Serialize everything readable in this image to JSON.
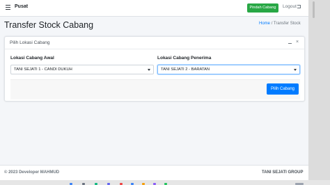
{
  "navbar": {
    "brand": "Pusat",
    "pindah_label": "Pindah Cabang",
    "logout_label": "Logout"
  },
  "header": {
    "title": "Transfer Stock Cabang",
    "breadcrumb": {
      "home": "Home",
      "separator": "/",
      "current": "Transfer Stock"
    }
  },
  "card": {
    "title": "Pilih Lokasi Cabang",
    "close_glyph": "×",
    "awal": {
      "label": "Lokasi Cabang Awal",
      "selected": "TANI SEJATI 1 - CANDI DUKUH"
    },
    "penerima": {
      "label": "Lokasi Cabang Penerima",
      "selected": "TANI SEJATI 2 - BARATAN"
    },
    "submit_label": "Pilih Cabang"
  },
  "footer": {
    "left": "© 2023 Developer MAHMUD",
    "right": "TANI SEJATI GROUP"
  },
  "colors": {
    "primary": "#007bff",
    "success": "#28a745",
    "background": "#f4f6f9"
  }
}
